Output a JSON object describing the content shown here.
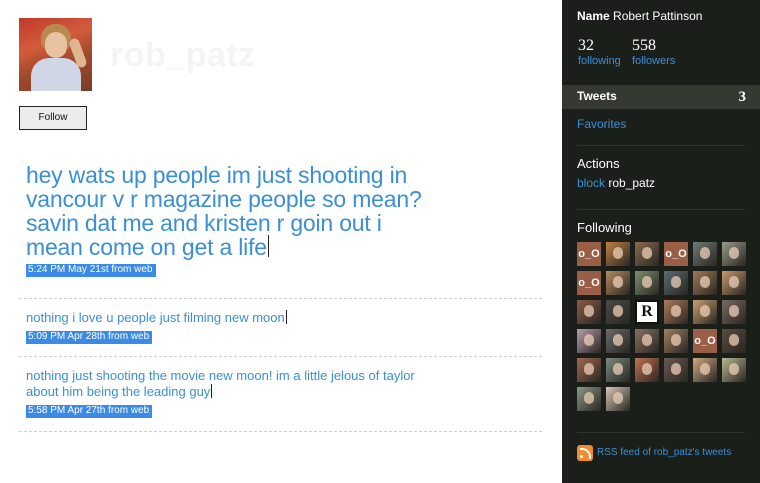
{
  "profile": {
    "screen_name": "rob_patz",
    "follow_label": "Follow"
  },
  "tweets": [
    {
      "text": "hey wats up people im just shooting in vancour v r magazine people so mean? savin dat me and kristen r goin out i mean come on get a life",
      "meta": "5:24 PM May 21st from web"
    },
    {
      "text": "nothing i love u people just filming new moon",
      "meta": "5:09 PM Apr 28th from web"
    },
    {
      "text": "nothing just shooting the movie new moon! im a little jelous of taylor about him being the leading guy",
      "meta": "5:58 PM Apr 27th from web"
    }
  ],
  "sidebar": {
    "name_label": "Name",
    "name_value": "Robert Pattinson",
    "following_count": "32",
    "following_label": "following",
    "followers_count": "558",
    "followers_label": "followers",
    "tweets_label": "Tweets",
    "tweets_count": "3",
    "favorites_label": "Favorites",
    "actions_title": "Actions",
    "block_label": "block",
    "block_target": "rob_patz",
    "following_title": "Following",
    "following_thumbs": [
      {
        "kind": "oo",
        "text": "o_O",
        "color": "#9a5d45"
      },
      {
        "kind": "photo",
        "color": "#c08040"
      },
      {
        "kind": "photo",
        "color": "#8a6a50"
      },
      {
        "kind": "oo",
        "text": "o_O",
        "color": "#9a5d45"
      },
      {
        "kind": "photo",
        "color": "#6f7a78"
      },
      {
        "kind": "photo",
        "color": "#9a9a8c"
      },
      {
        "kind": "oo",
        "text": "o_O",
        "color": "#9a5d45"
      },
      {
        "kind": "photo",
        "color": "#b88a60"
      },
      {
        "kind": "photo",
        "color": "#7d8f70"
      },
      {
        "kind": "photo",
        "color": "#5a6a70"
      },
      {
        "kind": "photo",
        "color": "#a07a58"
      },
      {
        "kind": "photo",
        "color": "#c49a70"
      },
      {
        "kind": "photo",
        "color": "#8c5a48"
      },
      {
        "kind": "photo",
        "color": "#4a4a48"
      },
      {
        "kind": "r",
        "text": "R"
      },
      {
        "kind": "photo",
        "color": "#b07a5a"
      },
      {
        "kind": "photo",
        "color": "#c8a070"
      },
      {
        "kind": "photo",
        "color": "#7a6a60"
      },
      {
        "kind": "photo",
        "color": "#b89cb0"
      },
      {
        "kind": "photo",
        "color": "#6a6a6a"
      },
      {
        "kind": "photo",
        "color": "#8a7060"
      },
      {
        "kind": "photo",
        "color": "#a08060"
      },
      {
        "kind": "oo",
        "text": "o_O",
        "color": "#9a5d45"
      },
      {
        "kind": "photo",
        "color": "#5a4a40"
      },
      {
        "kind": "photo",
        "color": "#a06a50"
      },
      {
        "kind": "photo",
        "color": "#7a8a80"
      },
      {
        "kind": "photo",
        "color": "#c07050"
      },
      {
        "kind": "photo",
        "color": "#6a5a50"
      },
      {
        "kind": "photo",
        "color": "#d0a880"
      },
      {
        "kind": "photo",
        "color": "#b8b890"
      },
      {
        "kind": "photo",
        "color": "#8a9a88"
      },
      {
        "kind": "photo",
        "color": "#d8c8b8"
      }
    ],
    "rss_label": "RSS feed of rob_patz's tweets"
  },
  "colors": {
    "link": "#3a8fd6",
    "sidebar_bg": "#1b1f1a",
    "meta_bg": "#3b8be6"
  }
}
